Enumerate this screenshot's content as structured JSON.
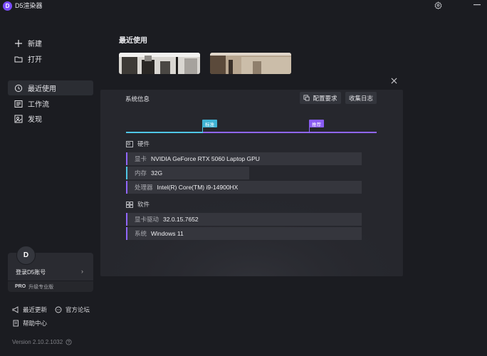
{
  "app": {
    "logo": "D",
    "title": "D5渲染器"
  },
  "window_controls": [
    "settings-icon",
    "minimize-icon"
  ],
  "sidebar": {
    "top_items": [
      {
        "label": "新建",
        "icon": "plus-icon"
      },
      {
        "label": "打开",
        "icon": "folder-icon"
      }
    ],
    "nav_items": [
      {
        "label": "最近使用",
        "icon": "history-icon",
        "active": true
      },
      {
        "label": "工作流",
        "icon": "workflow-icon",
        "active": false
      },
      {
        "label": "发现",
        "icon": "discover-icon",
        "active": false
      }
    ],
    "account": {
      "avatar_letter": "D",
      "login_label": "登录D5账号",
      "chevron": "›",
      "pro_badge": "PRO",
      "pro_label": "升级专业版"
    },
    "footer": {
      "updates": "最近更新",
      "forum": "官方论坛",
      "help": "帮助中心",
      "version": "Version 2.10.2.1032"
    }
  },
  "main": {
    "section_title": "最近使用"
  },
  "modal": {
    "title": "系统信息",
    "config_button": "配置要求",
    "logs_button": "收集日志",
    "standard_flag": "标准",
    "recommended_flag": "推荐",
    "hardware": {
      "heading": "硬件",
      "rows": [
        {
          "key": "显卡",
          "value": "NVIDIA GeForce RTX 5060 Laptop GPU"
        },
        {
          "key": "内存",
          "value": "32G"
        },
        {
          "key": "处理器",
          "value": "Intel(R) Core(TM) i9-14900HX"
        }
      ]
    },
    "software": {
      "heading": "软件",
      "rows": [
        {
          "key": "显卡驱动",
          "value": "32.0.15.7652"
        },
        {
          "key": "系统",
          "value": "Windows 11"
        }
      ]
    }
  },
  "colors": {
    "accent_purple": "#9066ff",
    "accent_blue": "#4fc6e6",
    "logo": "#7b4dff"
  }
}
